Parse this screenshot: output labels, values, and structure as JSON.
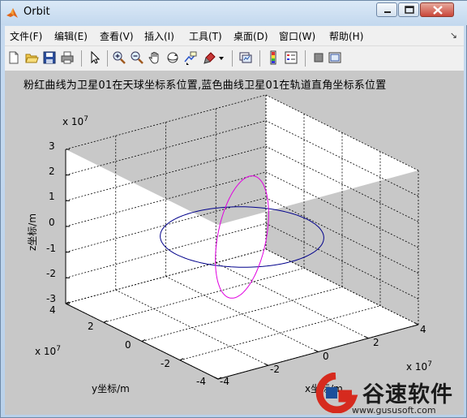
{
  "window": {
    "title": "Orbit",
    "min_label": "",
    "max_label": "",
    "close_label": ""
  },
  "menu": {
    "items": [
      "文件(F)",
      "编辑(E)",
      "查看(V)",
      "插入(I)",
      "工具(T)",
      "桌面(D)",
      "窗口(W)",
      "帮助(H)"
    ],
    "overflow": "↘"
  },
  "toolbar": {
    "icons": [
      "new-figure-icon",
      "open-file-icon",
      "save-icon",
      "print-icon",
      "pointer-icon",
      "zoom-in-icon",
      "zoom-out-icon",
      "pan-hand-icon",
      "rotate-3d-icon",
      "data-cursor-icon",
      "brush-icon",
      "brush-dropdown-icon",
      "link-plot-icon",
      "colorbar-icon",
      "legend-icon",
      "hide-plot-tools-icon",
      "show-plot-tools-icon"
    ]
  },
  "plot": {
    "title": "粉红曲线为卫星01在天球坐标系位置,蓝色曲线卫星01在轨道直角坐标系位置",
    "z_exponent_base": "x 10",
    "z_exponent_power": "7",
    "x_exponent_base": "x 10",
    "x_exponent_power": "7",
    "y_exponent_base": "x 10",
    "y_exponent_power": "7",
    "z_axis_label": "z坐标/m",
    "y_axis_label": "y坐标/m",
    "x_axis_label": "x坐标/m",
    "z_ticks": [
      "3",
      "2",
      "1",
      "0",
      "-1",
      "-2",
      "-3"
    ],
    "y_ticks": [
      "4",
      "2",
      "0",
      "-2",
      "-4"
    ],
    "x_ticks": [
      "-4",
      "-2",
      "0",
      "2",
      "4"
    ],
    "magenta_color": "#e000e0",
    "blue_color": "#00008b"
  },
  "watermark": {
    "brand": "谷速软件",
    "url": "www.gususoft.com"
  },
  "chart_data": {
    "type": "line",
    "title": "粉红曲线为卫星01在天球坐标系位置,蓝色曲线卫星01在轨道直角坐标系位置",
    "xlabel": "x坐标/m",
    "ylabel": "y坐标/m",
    "zlabel": "z坐标/m",
    "xlim": [
      -40000000.0,
      40000000.0
    ],
    "ylim": [
      -40000000.0,
      40000000.0
    ],
    "zlim": [
      -30000000.0,
      30000000.0
    ],
    "grid": true,
    "series": [
      {
        "kind": "ellipse-3d",
        "color": "#e000e0",
        "samples": [
          [
            0,
            0,
            22000000.0
          ],
          [
            19000000.0,
            11000000.0,
            0
          ],
          [
            0,
            0,
            -22000000.0
          ],
          [
            -19000000.0,
            -11000000.0,
            0
          ]
        ]
      },
      {
        "kind": "ellipse-3d",
        "color": "#00008b",
        "samples": [
          [
            26000000.0,
            0,
            0
          ],
          [
            0,
            26000000.0,
            0
          ],
          [
            -26000000.0,
            0,
            0
          ],
          [
            0,
            -26000000.0,
            0
          ]
        ]
      }
    ]
  }
}
